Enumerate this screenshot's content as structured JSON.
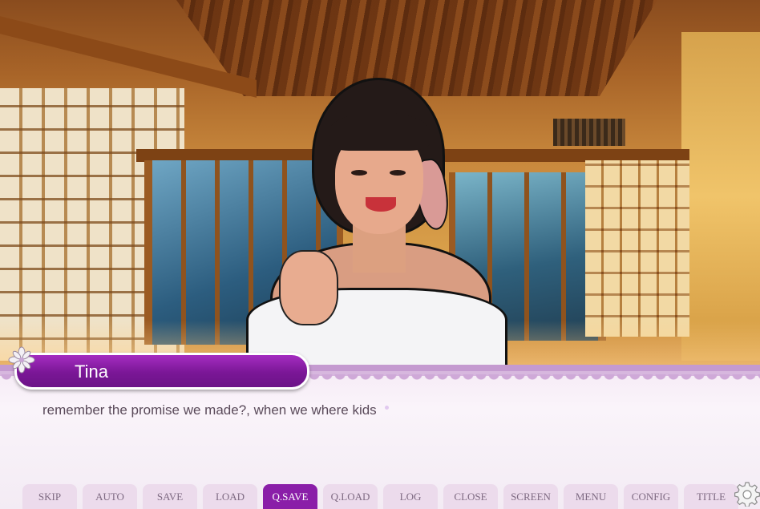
{
  "speaker": {
    "name": "Tina"
  },
  "dialogue": {
    "text": "remember the promise we made?, when we where kids"
  },
  "quickmenu": {
    "buttons": [
      {
        "label": "SKIP",
        "active": false
      },
      {
        "label": "AUTO",
        "active": false
      },
      {
        "label": "SAVE",
        "active": false
      },
      {
        "label": "LOAD",
        "active": false
      },
      {
        "label": "Q.SAVE",
        "active": true
      },
      {
        "label": "Q.LOAD",
        "active": false
      },
      {
        "label": "LOG",
        "active": false
      },
      {
        "label": "CLOSE",
        "active": false
      },
      {
        "label": "SCREEN",
        "active": false
      },
      {
        "label": "MENU",
        "active": false
      },
      {
        "label": "CONFIG",
        "active": false
      },
      {
        "label": "TITLE",
        "active": false
      }
    ]
  },
  "icons": {
    "settings": "gear-icon",
    "namebox_decoration": "flower-icon",
    "continue_indicator": "ctc-icon"
  },
  "colors": {
    "accent": "#8a1ea8",
    "button_bg": "#ecdbec",
    "text": "#5a4a5a"
  }
}
